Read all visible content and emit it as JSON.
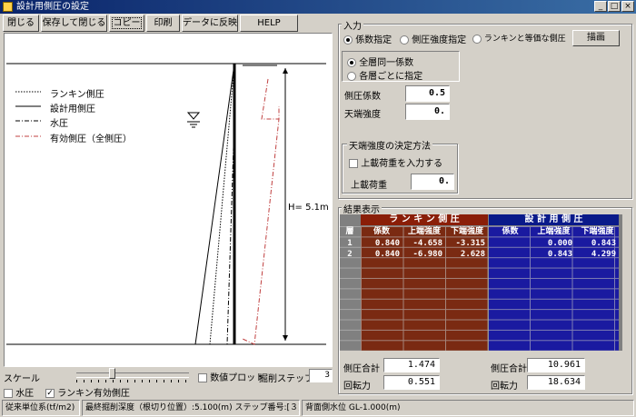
{
  "window": {
    "title": "設計用側圧の設定"
  },
  "toolbar": {
    "close": "閉じる",
    "save_close": "保存して閉じる",
    "copy": "コピー",
    "print": "印刷",
    "reflect": "データに反映",
    "help": "HELP"
  },
  "legend": {
    "rankine": "ランキン側圧",
    "design": "設計用側圧",
    "water": "水圧",
    "effective": "有効側圧（全側圧）"
  },
  "diagram": {
    "height_label": "H= 5.1m"
  },
  "bottom_controls": {
    "scale_label": "スケール",
    "numeric_plot": "数値プロット",
    "excavation_step": "掘削ステップ",
    "step_value": "3",
    "water_chk": "水圧",
    "rankine_eff_chk": "ランキン有効側圧"
  },
  "input": {
    "title": "入力",
    "mode_options": [
      "係数指定",
      "側圧強度指定",
      "ランキンと等価な側圧"
    ],
    "draw_button": "描画",
    "layer_options": [
      "全層同一係数",
      "各層ごとに指定"
    ],
    "coef_label": "側圧係数",
    "coef_value": "0.5",
    "top_label": "天端強度",
    "top_value": "0.",
    "method_title": "天端強度の決定方法",
    "surcharge_chk": "上載荷重を入力する",
    "surcharge_label": "上載荷重",
    "surcharge_value": "0."
  },
  "results": {
    "title": "結果表示",
    "group_rankine": "ラ ン キ ン 側 圧",
    "group_design": "設 計 用 側 圧",
    "headers": [
      "層",
      "係数",
      "上端強度",
      "下端強度",
      "係数",
      "上端強度",
      "下端強度"
    ],
    "rows": [
      [
        "1",
        "0.840",
        "-4.658",
        "-3.315",
        "",
        "0.000",
        "0.843"
      ],
      [
        "2",
        "0.840",
        "-6.980",
        "2.628",
        "",
        "0.843",
        "4.299"
      ]
    ],
    "sum_label": "側圧合計",
    "rankine_sum": "1.474",
    "design_sum": "10.961",
    "moment_label": "回転力",
    "rankine_moment": "0.551",
    "design_moment": "18.634"
  },
  "status": {
    "units": "従来単位系(tf/m2)",
    "depth": "最終掘削深度（根切り位置）:5.100(m) ステップ番号:[３]",
    "water": "背面側水位 GL-1.000(m)"
  },
  "colors": {
    "rankine_bg": "#7a2a12",
    "design_bg": "#1a1aa0",
    "rankine_hdr": "#8a1e08",
    "design_hdr": "#0a1a8a"
  }
}
